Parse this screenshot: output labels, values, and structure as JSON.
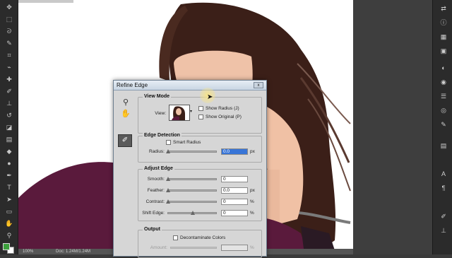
{
  "dialog": {
    "title": "Refine Edge",
    "close_label": "x",
    "view_mode": {
      "title": "View Mode",
      "view_label": "View:",
      "show_radius": "Show Radius (J)",
      "show_original": "Show Original (P)"
    },
    "edge_detection": {
      "title": "Edge Detection",
      "smart_radius": "Smart Radius",
      "radius_label": "Radius:",
      "radius_value": "0.0",
      "radius_unit": "px"
    },
    "adjust_edge": {
      "title": "Adjust Edge",
      "smooth_label": "Smooth:",
      "smooth_value": "0",
      "feather_label": "Feather:",
      "feather_value": "0.0",
      "feather_unit": "px",
      "contrast_label": "Contrast:",
      "contrast_value": "0",
      "contrast_unit": "%",
      "shift_label": "Shift Edge:",
      "shift_value": "0",
      "shift_unit": "%"
    },
    "output": {
      "title": "Output",
      "decontaminate": "Decontaminate Colors",
      "amount_label": "Amount:",
      "amount_unit": "%"
    }
  },
  "statusbar": {
    "zoom": "100%",
    "doc": "Doc: 1.24M/1.24M"
  },
  "colors": {
    "foreground": "#3ca03c",
    "background": "#ffffff",
    "accent": "#3875d7"
  }
}
